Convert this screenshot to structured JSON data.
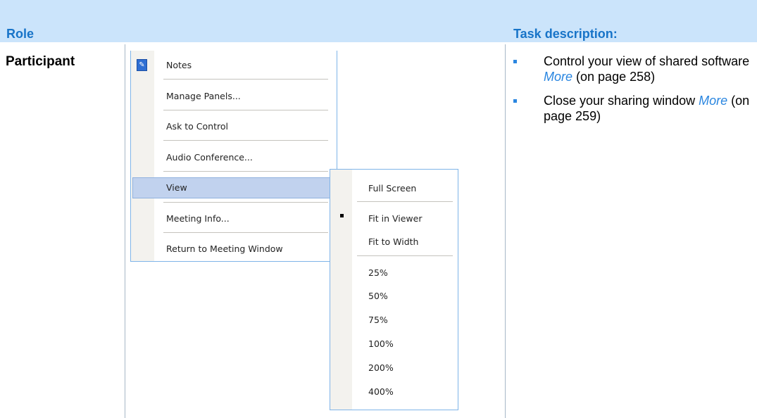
{
  "table": {
    "header": {
      "role": "Role",
      "task": "Task description:"
    },
    "row": {
      "role": "Participant"
    }
  },
  "menu": {
    "items": [
      "Notes",
      "Manage Panels...",
      "Ask to Control",
      "Audio Conference...",
      "View",
      "Meeting Info...",
      "Return to Meeting Window"
    ],
    "notes_icon": "notes-icon",
    "highlighted": "View"
  },
  "submenu": {
    "items": [
      "Full Screen",
      "Fit in Viewer",
      "Fit to Width",
      "25%",
      "50%",
      "75%",
      "100%",
      "200%",
      "400%"
    ],
    "selected": "Fit in Viewer"
  },
  "tasks": [
    {
      "text": "Control your view of shared software",
      "link": "More",
      "page_ref": "(on page 258)"
    },
    {
      "text": "Close your sharing window",
      "link": "More",
      "page_ref": "(on page 259)"
    }
  ],
  "colors": {
    "header_bg": "#cbe4fb",
    "header_text": "#1874c8",
    "link": "#2a86e0"
  }
}
